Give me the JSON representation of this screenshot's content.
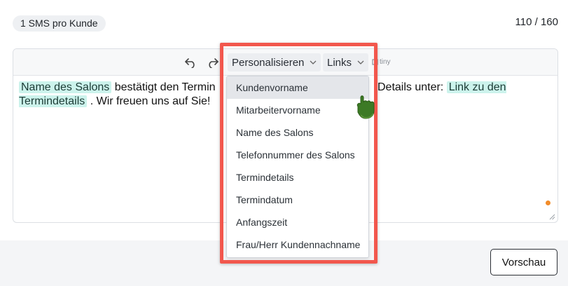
{
  "header": {
    "badge": "1 SMS pro Kunde",
    "counter": "110 / 160"
  },
  "toolbar": {
    "undo_icon": "undo-icon",
    "redo_icon": "redo-icon",
    "personalize_label": "Personalisieren",
    "links_label": "Links",
    "tiny_label": "tiny"
  },
  "editor": {
    "segments": [
      {
        "type": "tag",
        "text": "Name des Salons"
      },
      {
        "type": "text",
        "text": " bestätigt den Termin "
      },
      {
        "type": "text",
        "text": "Details unter: "
      },
      {
        "type": "tag",
        "text": "Link zu den Termindetails"
      },
      {
        "type": "text",
        "text": " . Wir freuen uns auf Sie!"
      }
    ]
  },
  "personalize_menu": {
    "items": [
      "Kundenvorname",
      "Mitarbeitervorname",
      "Name des Salons",
      "Telefonnummer des Salons",
      "Termindetails",
      "Termindatum",
      "Anfangszeit",
      "Frau/Herr Kundennachname"
    ],
    "active_index": 0
  },
  "footer": {
    "preview_label": "Vorschau"
  },
  "colors": {
    "highlight_border": "#f2574d",
    "tag_bg": "#ccf3ec",
    "status_dot": "#f28c2a"
  }
}
